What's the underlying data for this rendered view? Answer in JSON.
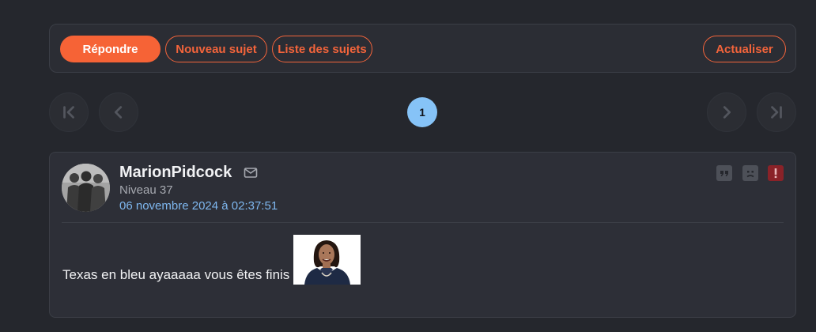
{
  "toolbar": {
    "reply_label": "Répondre",
    "new_topic_label": "Nouveau sujet",
    "topic_list_label": "Liste des sujets",
    "refresh_label": "Actualiser"
  },
  "pagination": {
    "current_page": "1",
    "first_icon": "first-page-icon",
    "prev_icon": "chevron-left-icon",
    "next_icon": "chevron-right-icon",
    "last_icon": "last-page-icon"
  },
  "post": {
    "username": "MarionPidcock",
    "level": "Niveau 37",
    "date": "06 novembre 2024 à 02:37:51",
    "message": "Texas en bleu ayaaaaa vous êtes finis",
    "actions": [
      "quote-icon",
      "sad-face-icon",
      "alert-icon"
    ]
  },
  "colors": {
    "background": "#25272d",
    "accent": "#f66336",
    "page_active": "#86c3f7",
    "link": "#7eb7ef",
    "alert": "#8a2228"
  }
}
